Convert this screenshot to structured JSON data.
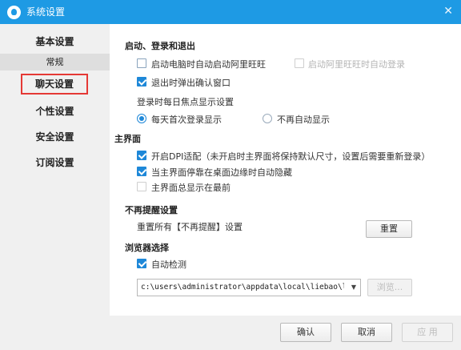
{
  "window": {
    "title": "系统设置",
    "close_glyph": "✕"
  },
  "sidebar": {
    "items": [
      {
        "label": "基本设置"
      },
      {
        "label": "常规"
      },
      {
        "label": "聊天设置"
      },
      {
        "label": "个性设置"
      },
      {
        "label": "安全设置"
      },
      {
        "label": "订阅设置"
      }
    ]
  },
  "startup": {
    "heading": "启动、登录和退出",
    "auto_start": {
      "label": "启动电脑时自动启动阿里旺旺",
      "checked": false
    },
    "auto_login": {
      "label": "启动阿里旺旺时自动登录",
      "checked": false,
      "disabled": true
    },
    "exit_confirm": {
      "label": "退出时弹出确认窗口",
      "checked": true
    },
    "focus_label": "登录时每日焦点显示设置",
    "focus_daily": {
      "label": "每天首次登录显示",
      "selected": true
    },
    "focus_never": {
      "label": "不再自动显示",
      "selected": false
    }
  },
  "main_ui": {
    "heading": "主界面",
    "dpi": {
      "label": "开启DPI适配（未开启时主界面将保持默认尺寸，设置后需要重新登录）",
      "checked": true
    },
    "autohide": {
      "label": "当主界面停靠在桌面边缘时自动隐藏",
      "checked": true
    },
    "topmost": {
      "label": "主界面总显示在最前",
      "checked": false
    }
  },
  "no_remind": {
    "heading": "不再提醒设置",
    "reset_label": "重置所有【不再提醒】设置",
    "reset_button": "重置"
  },
  "browser": {
    "heading": "浏览器选择",
    "auto_detect": {
      "label": "自动检测",
      "checked": true
    },
    "path": "c:\\users\\administrator\\appdata\\local\\liebao\\li",
    "browse_button": "浏览..."
  },
  "footer": {
    "ok": "确认",
    "cancel": "取消",
    "apply": "应 用"
  },
  "colors": {
    "titlebar": "#1e9ae4",
    "accent": "#1e88d8",
    "highlight": "#e53935"
  }
}
